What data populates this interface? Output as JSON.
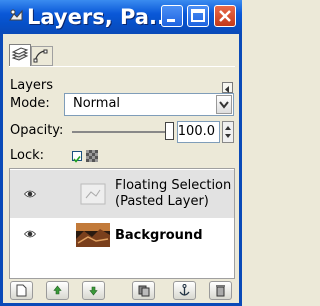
{
  "window": {
    "title": "Layers, Pa...",
    "buttons": [
      "minimize",
      "maximize",
      "close"
    ]
  },
  "tabs": [
    {
      "name": "layers-tab",
      "icon": "layers-icon",
      "active": true
    },
    {
      "name": "paths-tab",
      "icon": "paths-icon",
      "active": false
    }
  ],
  "panel": {
    "title": "Layers",
    "mode_label": "Mode:",
    "mode_value": "Normal",
    "opacity_label": "Opacity:",
    "opacity_value": "100.0",
    "lock_label": "Lock:",
    "lock_pixels_checked": true
  },
  "layers": [
    {
      "name_line1": "Floating Selection",
      "name_line2": "(Pasted Layer)",
      "visible": true,
      "selected": true
    },
    {
      "name": "Background",
      "visible": true,
      "selected": false
    }
  ],
  "toolbar_icons": [
    "new-layer-icon",
    "raise-layer-icon",
    "lower-layer-icon",
    "duplicate-layer-icon",
    "anchor-layer-icon",
    "delete-layer-icon"
  ],
  "colors": {
    "titlebar": "#0a58d8",
    "close_button": "#c4391a",
    "selection": "#e2e2e2"
  }
}
